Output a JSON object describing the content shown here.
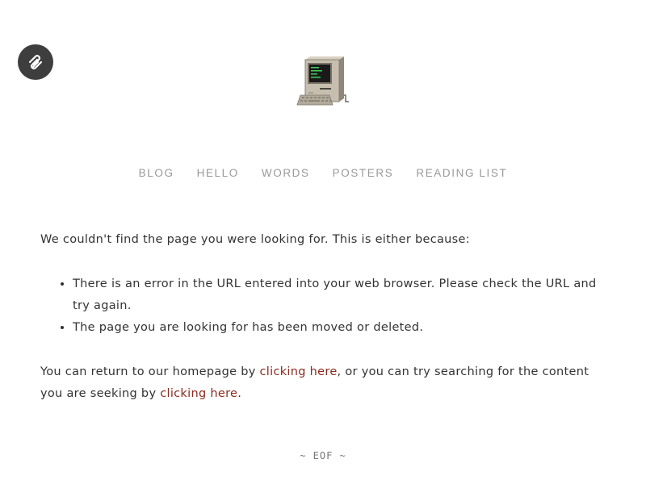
{
  "icons": {
    "platform_badge": "squarespace-logo-icon",
    "site_logo": "vintage-computer-icon"
  },
  "nav": {
    "items": [
      {
        "label": "BLOG"
      },
      {
        "label": "HELLO"
      },
      {
        "label": "WORDS"
      },
      {
        "label": "POSTERS"
      },
      {
        "label": "READING LIST"
      }
    ]
  },
  "content": {
    "intro": "We couldn't find the page you were looking for. This is either because:",
    "reasons": [
      "There is an error in the URL entered into your web browser. Please check the URL and try again.",
      "The page you are looking for has been moved or deleted."
    ],
    "outro": {
      "part1": "You can return to our homepage by ",
      "link1": "clicking here",
      "part2": ", or you can try searching for the content you are seeking by ",
      "link2": "clicking here",
      "part3": "."
    }
  },
  "footer": {
    "eof": "~ EOF ~"
  },
  "colors": {
    "link": "#8b2a1e",
    "nav": "#999999",
    "text": "#333333",
    "badge_bg": "#3e3e3e"
  }
}
